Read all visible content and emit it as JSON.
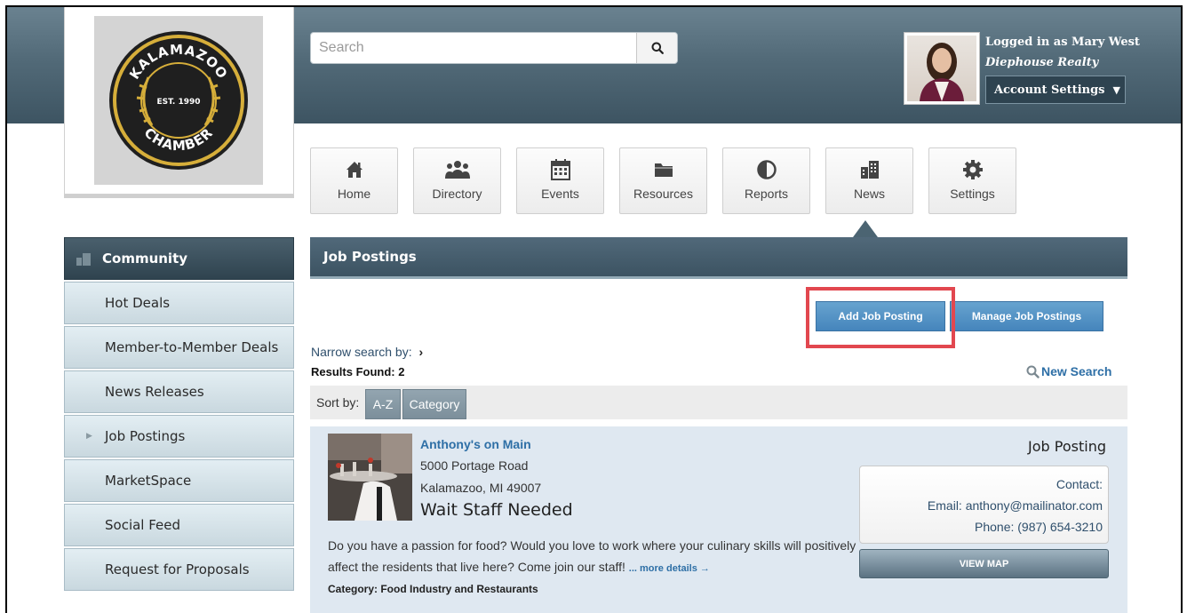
{
  "search": {
    "placeholder": "Search"
  },
  "logo": {
    "top_text": "KALAMAZOO",
    "bottom_text": "CHAMBER",
    "center_text": "EST. 1990"
  },
  "user": {
    "logged_in_text": "Logged in as Mary West",
    "company": "Diephouse Realty",
    "account_settings_label": "Account Settings"
  },
  "nav": {
    "items": [
      {
        "label": "Home",
        "icon": "home-icon"
      },
      {
        "label": "Directory",
        "icon": "people-icon"
      },
      {
        "label": "Events",
        "icon": "calendar-icon"
      },
      {
        "label": "Resources",
        "icon": "folder-icon"
      },
      {
        "label": "Reports",
        "icon": "chart-pie-icon"
      },
      {
        "label": "News",
        "icon": "buildings-icon"
      },
      {
        "label": "Settings",
        "icon": "gear-icon"
      }
    ],
    "active": "News"
  },
  "sidebar": {
    "header": "Community",
    "items": [
      {
        "label": "Hot Deals"
      },
      {
        "label": "Member-to-Member Deals"
      },
      {
        "label": "News Releases"
      },
      {
        "label": "Job Postings",
        "active": true
      },
      {
        "label": "MarketSpace"
      },
      {
        "label": "Social Feed"
      },
      {
        "label": "Request for Proposals"
      }
    ]
  },
  "main": {
    "title": "Job Postings",
    "add_button": "Add Job Posting",
    "manage_button": "Manage Job Postings",
    "narrow_label": "Narrow search by:",
    "results_text": "Results Found: 2",
    "new_search_label": "New Search",
    "sort_label": "Sort by:",
    "sort_options": [
      "A-Z",
      "Category"
    ]
  },
  "listing": {
    "business": "Anthony's on Main",
    "address1": "5000 Portage Road",
    "address2": "Kalamazoo, MI 49007",
    "title": "Wait Staff Needed",
    "description": "Do you have a passion for food? Would you love to work where your culinary skills will positively affect the residents that live here? Come join our staff!",
    "more_label": "... more details →",
    "category": "Category: Food Industry and Restaurants",
    "type_label": "Job Posting",
    "contact_label": "Contact:",
    "email": "Email: anthony@mailinator.com",
    "phone": "Phone: (987) 654-3210",
    "view_map_label": "VIEW MAP"
  },
  "colors": {
    "header": "#4f6775",
    "accent_blue": "#4a8ac0",
    "highlight_red": "#e2474f",
    "link": "#2e6fa6"
  }
}
